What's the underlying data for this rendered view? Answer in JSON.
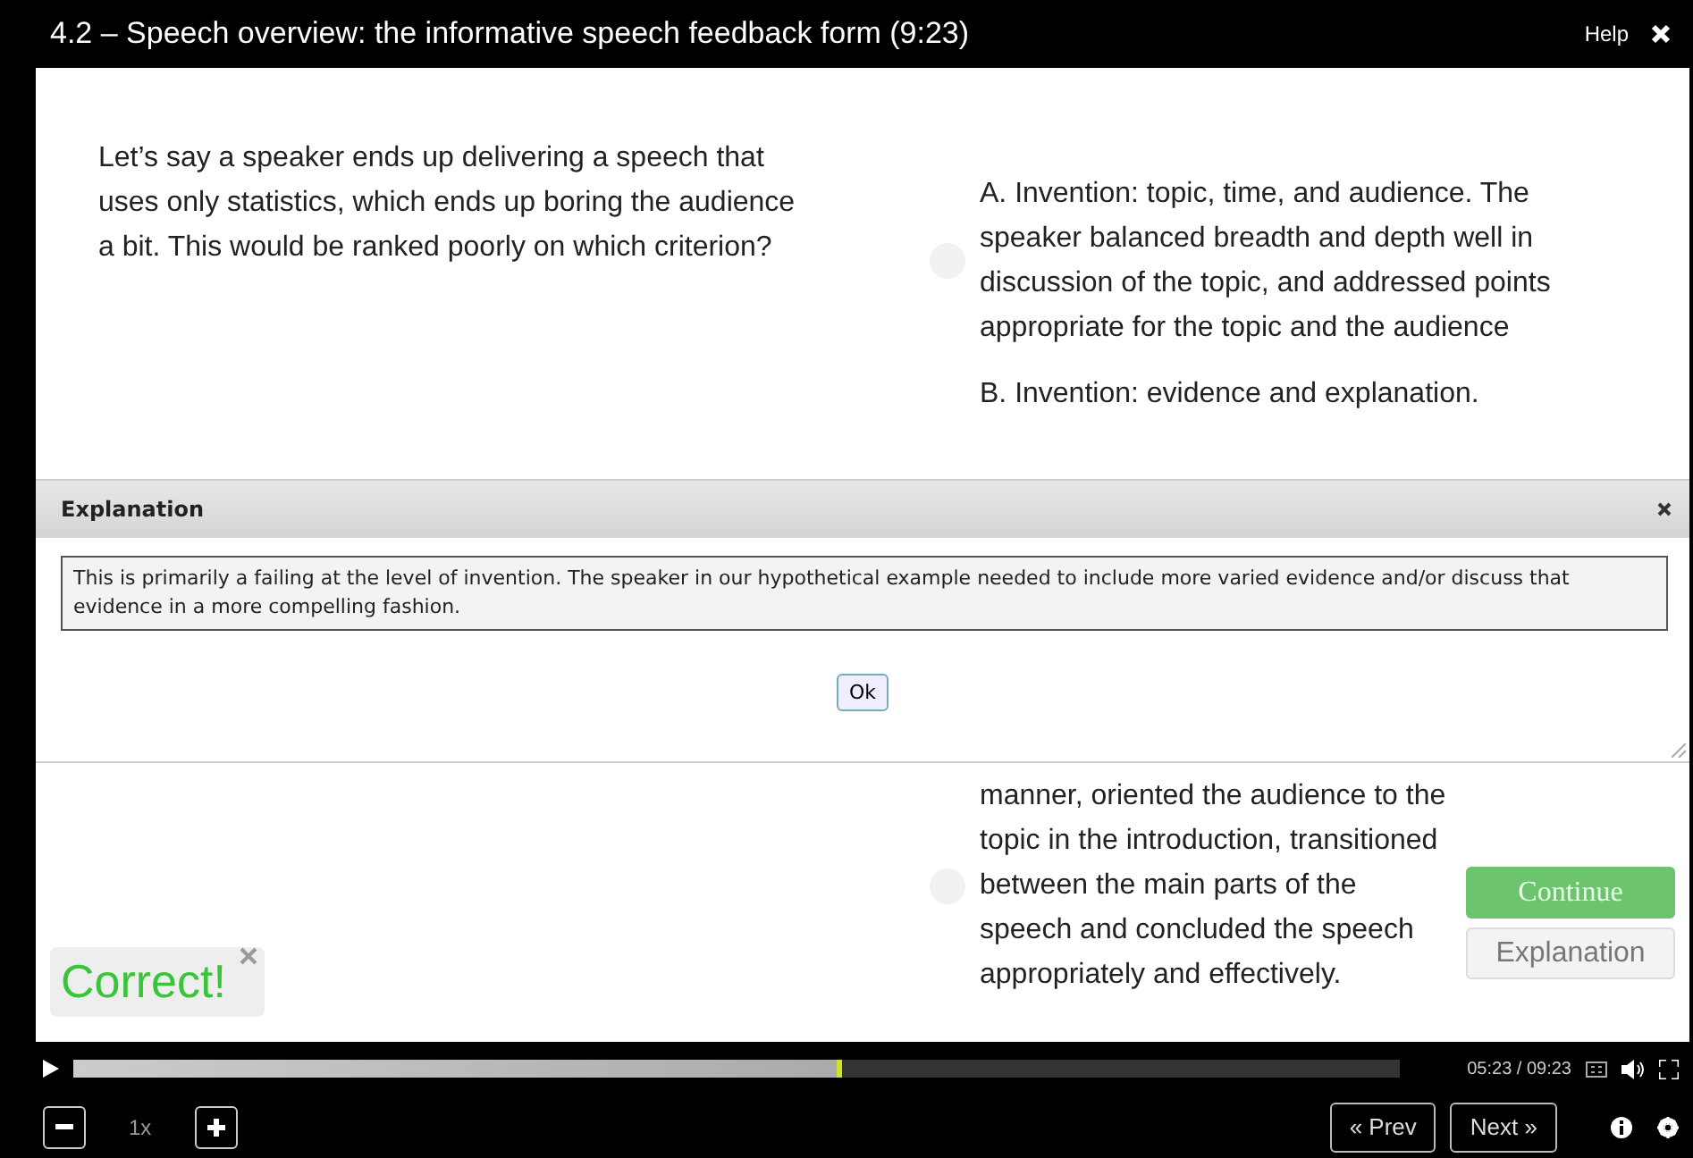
{
  "window": {
    "title": "4.2 – Speech overview: the informative speech feedback form (9:23)",
    "help": "Help"
  },
  "question": {
    "text": "Let’s say a speaker ends up delivering a speech that uses only statistics, which ends up boring the audience a bit. This would be ranked poorly on which criterion?"
  },
  "options": [
    {
      "text": "A. Invention: topic, time, and audience. The speaker balanced breadth and depth well in discussion of the topic, and addressed points appropriate for the topic and the audience",
      "selected": false,
      "kind": "choice"
    },
    {
      "text": "B. Invention: evidence and explanation.",
      "kind": "fragment"
    },
    {
      "text": "manner, oriented the audience to the topic in the introduction, transitioned between the main parts of the speech and concluded the speech appropriately and effectively.",
      "selected": false,
      "kind": "choice"
    }
  ],
  "dialog": {
    "title": "Explanation",
    "body": "This is primarily a failing at the level of invention. The speaker in our hypothetical example needed to include more varied evidence and/or discuss that evidence in a more compelling fashion.",
    "ok": "Ok"
  },
  "actions": {
    "continue": "Continue",
    "explanation": "Explanation"
  },
  "feedback": {
    "text": "Correct!"
  },
  "player": {
    "level": 0.58,
    "time": "05:23 / 09:23",
    "speed": "1x",
    "prev": "« Prev",
    "next": "Next »"
  }
}
